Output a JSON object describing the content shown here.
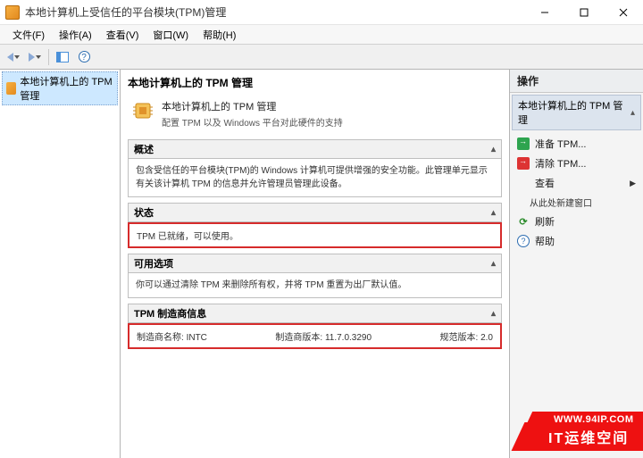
{
  "window": {
    "title": "本地计算机上受信任的平台模块(TPM)管理"
  },
  "menu": {
    "file": "文件(F)",
    "action": "操作(A)",
    "view": "查看(V)",
    "window": "窗口(W)",
    "help": "帮助(H)"
  },
  "tree": {
    "root": "本地计算机上的 TPM 管理"
  },
  "mid": {
    "heading": "本地计算机上的 TPM 管理",
    "intro_line1": "本地计算机上的 TPM 管理",
    "intro_line2": "配置 TPM 以及 Windows 平台对此硬件的支持",
    "overview": {
      "title": "概述",
      "body": "包含受信任的平台模块(TPM)的 Windows 计算机可提供增强的安全功能。此管理单元显示有关该计算机 TPM 的信息并允许管理员管理此设备。"
    },
    "status": {
      "title": "状态",
      "body": "TPM 已就绪，可以使用。"
    },
    "options": {
      "title": "可用选项",
      "body": "你可以通过清除 TPM 来删除所有权，并将 TPM 重置为出厂默认值。"
    },
    "maker": {
      "title": "TPM 制造商信息",
      "name_label": "制造商名称:",
      "name_value": "INTC",
      "ver_label": "制造商版本:",
      "ver_value": "11.7.0.3290",
      "spec_label": "规范版本:",
      "spec_value": "2.0"
    }
  },
  "actions": {
    "pane_title": "操作",
    "group_title": "本地计算机上的 TPM 管理",
    "prepare": "准备 TPM...",
    "clear": "清除 TPM...",
    "view": "查看",
    "new_window": "从此处新建窗口",
    "refresh": "刷新",
    "help": "帮助"
  },
  "watermark": {
    "url": "WWW.94IP.COM",
    "brand": "IT运维空间"
  }
}
